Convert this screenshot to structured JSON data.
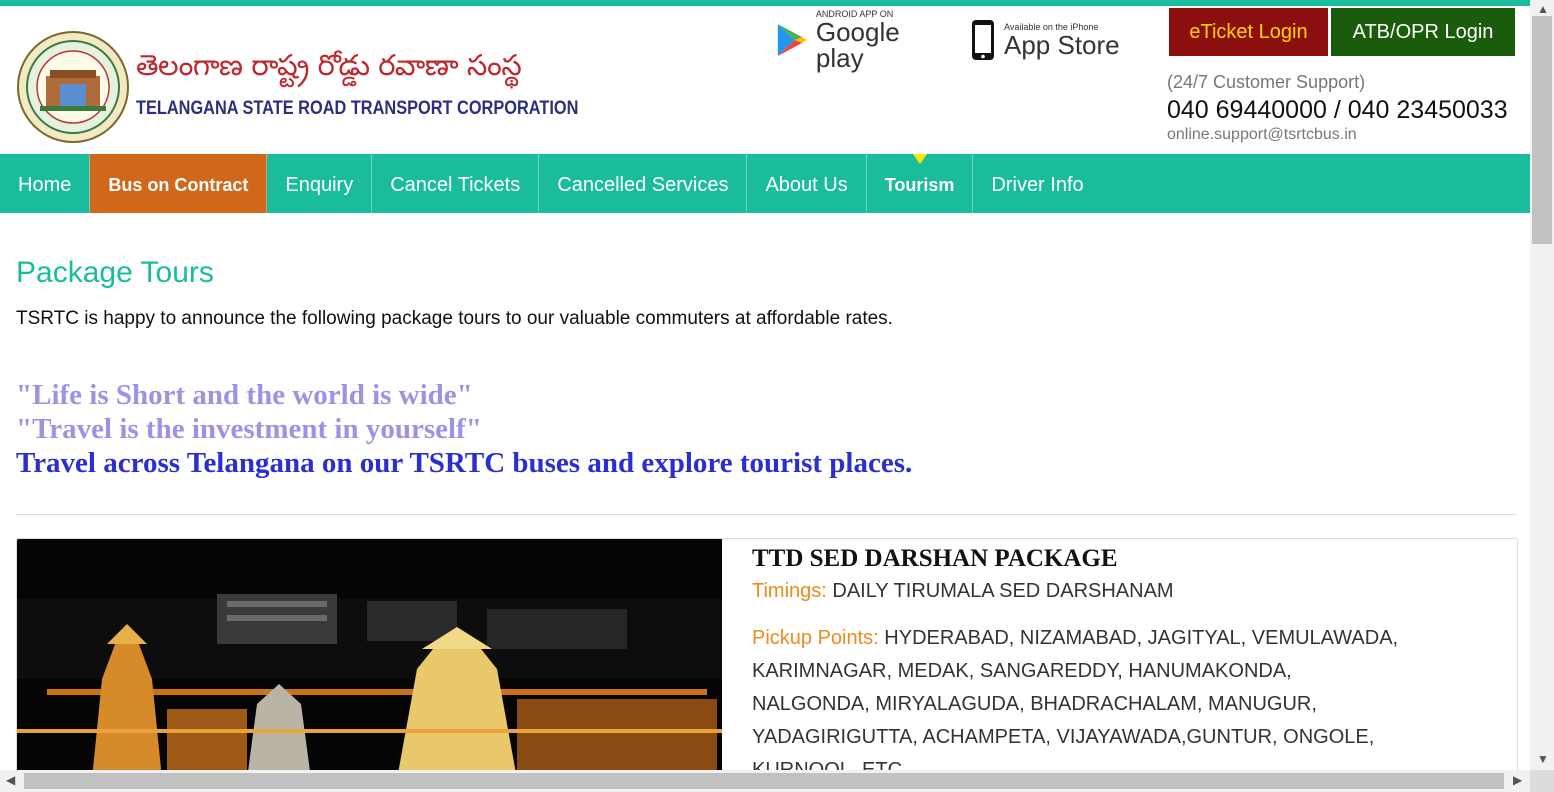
{
  "header": {
    "brand_telugu": "తెలంగాణ రాష్ట్ర రోడ్డు రవాణా సంస్థ",
    "brand_english": "TELANGANA STATE ROAD TRANSPORT CORPORATION",
    "google_play_small": "ANDROID APP ON",
    "google_play_big": "Google play",
    "app_store_small": "Available on the iPhone",
    "app_store_big": "App Store",
    "eticket_login": "eTicket Login",
    "atb_login": "ATB/OPR Login",
    "support_label": "(24/7 Customer Support)",
    "support_phone": "040 69440000 / 040 23450033",
    "support_email": "online.support@tsrtcbus.in"
  },
  "nav": {
    "home": "Home",
    "bus_on_contract": "Bus on Contract",
    "enquiry": "Enquiry",
    "cancel_tickets": "Cancel Tickets",
    "cancelled_services": "Cancelled Services",
    "about_us": "About Us",
    "tourism": "Tourism",
    "driver_info": "Driver Info"
  },
  "main": {
    "title": "Package Tours",
    "intro": "TSRTC is happy to announce the following package tours to our valuable commuters at affordable rates.",
    "quote1": "\"Life is Short and the world is wide\"",
    "quote2": "\"Travel is the investment in yourself\"",
    "quote3": "Travel across Telangana on our TSRTC buses and explore tourist places."
  },
  "package": {
    "title": "TTD SED DARSHAN PACKAGE",
    "timings_label": "Timings:",
    "timings_value": "DAILY TIRUMALA SED DARSHANAM",
    "pickup_label": "Pickup Points:",
    "pickup_line1": "HYDERABAD, NIZAMABAD, JAGITYAL, VEMULAWADA,",
    "pickup_line2": "KARIMNAGAR, MEDAK, SANGAREDDY, HANUMAKONDA,",
    "pickup_line3": "NALGONDA, MIRYALAGUDA, BHADRACHALAM, MANUGUR,",
    "pickup_line4": "YADAGIRIGUTTA, ACHAMPETA, VIJAYAWADA,GUNTUR, ONGOLE,",
    "pickup_line5": "KURNOOL, ETC.."
  },
  "colors": {
    "accent": "#1bbc9b",
    "contract_tab": "#d0671b",
    "eticket_bg": "#8b0f0f",
    "atb_bg": "#1a5c0c"
  }
}
